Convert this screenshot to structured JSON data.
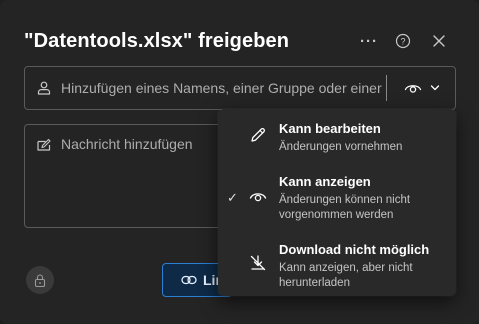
{
  "dialog": {
    "title": "\"Datentools.xlsx\" freigeben",
    "more_label": "···",
    "help_label": "?",
    "close_label": "✕"
  },
  "share": {
    "search_placeholder": "Hinzufügen eines Namens, einer Gruppe oder einer E-Mail-Adresse",
    "permission_icon": "eye-icon",
    "message_placeholder": "Nachricht hinzufügen"
  },
  "footer": {
    "link_label": "Lin"
  },
  "permission_menu": {
    "selected_index": 1,
    "check": "✓",
    "items": [
      {
        "icon": "pencil-icon",
        "title": "Kann bearbeiten",
        "description": "Änderungen vornehmen"
      },
      {
        "icon": "eye-icon",
        "title": "Kann anzeigen",
        "description": "Änderungen können nicht vorgenommen werden"
      },
      {
        "icon": "no-download-icon",
        "title": "Download nicht möglich",
        "description": "Kann anzeigen, aber nicht herunterladen"
      }
    ]
  },
  "colors": {
    "background": "#242424",
    "menu_background": "#292929",
    "accent": "#2b7fd4"
  }
}
